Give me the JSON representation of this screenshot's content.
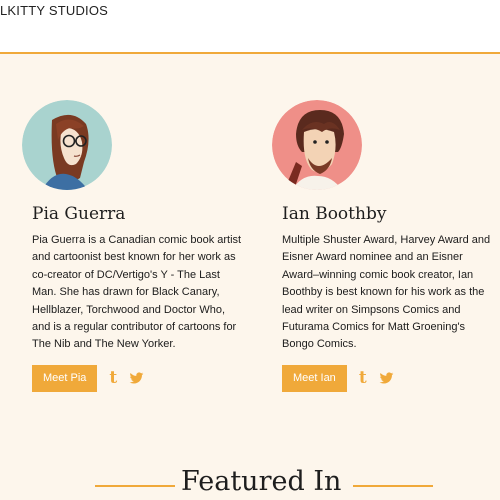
{
  "header": {
    "brand": "LKITTY STUDIOS"
  },
  "colors": {
    "accent": "#f0a93a",
    "background": "#fdf6ec"
  },
  "people": [
    {
      "name": "Pia Guerra",
      "bio": "Pia Guerra is a Canadian comic book artist and cartoonist best known for her work as co-creator of DC/Vertigo's Y - The Last Man. She has drawn for Black Canary, Hellblazer, Torchwood and Doctor Who, and is a regular contributor of cartoons for The Nib and The New Yorker.",
      "button": "Meet Pia",
      "avatar_icon": "pia-guerra-portrait",
      "social": [
        "tumblr-icon",
        "twitter-icon"
      ]
    },
    {
      "name": "Ian Boothby",
      "bio": "Multiple Shuster Award, Harvey Award and Eisner Award nominee and an Eisner Award–winning comic book creator, Ian Boothby is best known for his work as the lead writer on Simpsons Comics and Futurama Comics for Matt Groening's Bongo Comics.",
      "button": "Meet Ian",
      "avatar_icon": "ian-boothby-portrait",
      "social": [
        "tumblr-icon",
        "twitter-icon"
      ]
    }
  ],
  "featured": {
    "title": "Featured In"
  }
}
